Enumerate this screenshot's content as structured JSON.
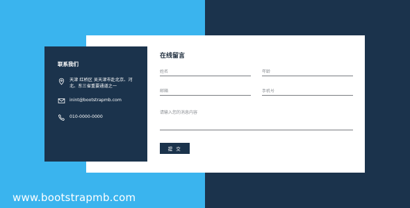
{
  "contact": {
    "title": "联系我们",
    "address": "天津 红桥区 吴天津市赴北京、河北、东三省重要通道之一",
    "email": "inint@bootstrapmb.com",
    "phone": "010-0000-0000",
    "icons": [
      "location-pin-icon",
      "envelope-icon",
      "phone-icon"
    ]
  },
  "form": {
    "title": "在线留言",
    "name_placeholder": "姓名",
    "age_placeholder": "年龄",
    "email_placeholder": "邮箱",
    "phone_placeholder": "手机号",
    "message_placeholder": "请输入您的消息内容",
    "submit_label": "提 交"
  },
  "watermark": "www.bootstrapmb.com",
  "colors": {
    "light_blue": "#3ab4ee",
    "navy": "#1b334c",
    "card": "#ffffff"
  }
}
